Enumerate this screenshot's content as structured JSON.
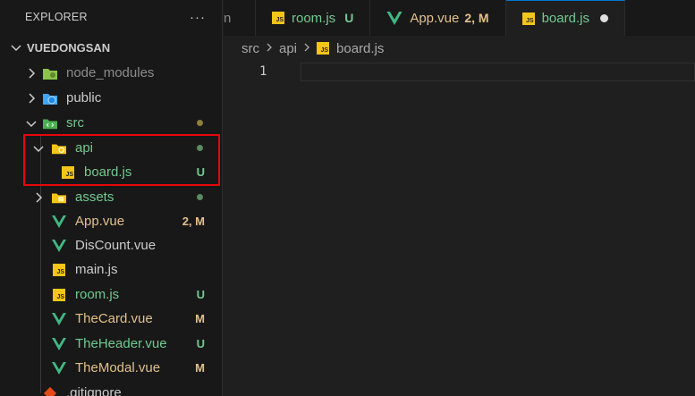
{
  "explorer": {
    "title": "EXPLORER",
    "more": "···",
    "project": "VUEDONGSAN",
    "items": [
      {
        "label": "node_modules",
        "badge": ""
      },
      {
        "label": "public",
        "badge": ""
      },
      {
        "label": "src",
        "badge": ""
      },
      {
        "label": "api",
        "badge": ""
      },
      {
        "label": "board.js",
        "badge": "U"
      },
      {
        "label": "assets",
        "badge": ""
      },
      {
        "label": "App.vue",
        "badge": "2, M"
      },
      {
        "label": "DisCount.vue",
        "badge": ""
      },
      {
        "label": "main.js",
        "badge": ""
      },
      {
        "label": "room.js",
        "badge": "U"
      },
      {
        "label": "TheCard.vue",
        "badge": "M"
      },
      {
        "label": "TheHeader.vue",
        "badge": "U"
      },
      {
        "label": "TheModal.vue",
        "badge": "M"
      },
      {
        "label": ".gitignore",
        "badge": ""
      }
    ]
  },
  "tabs": [
    {
      "label": "n",
      "badge": ""
    },
    {
      "label": "room.js",
      "badge": "U"
    },
    {
      "label": "App.vue",
      "badge": "2, M"
    },
    {
      "label": "board.js",
      "badge": ""
    }
  ],
  "breadcrumb": {
    "parts": [
      "src",
      "api",
      "board.js"
    ]
  },
  "editor": {
    "line_number": "1"
  },
  "colors": {
    "untracked": "#73c991",
    "modified": "#e2c08d",
    "folder_dot_src": "#8f7d3c",
    "folder_dot_green": "#5a8a62",
    "vue_green": "#41b883",
    "js_yellow": "#f5c518"
  }
}
